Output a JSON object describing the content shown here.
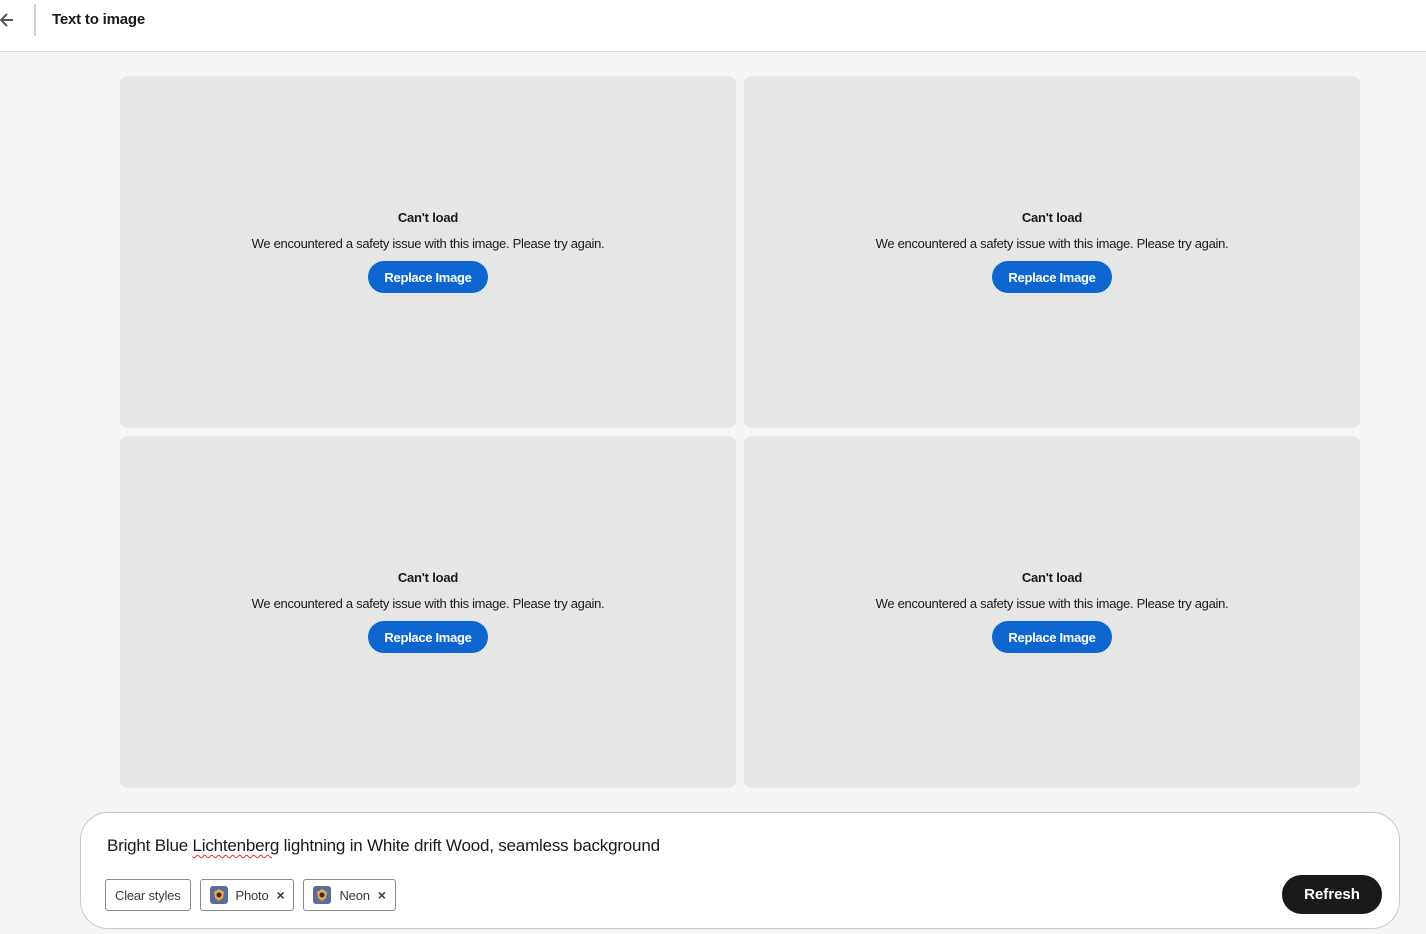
{
  "header": {
    "back_icon": "arrow-left-icon",
    "title": "Text to image"
  },
  "results": [
    {
      "title": "Can't load",
      "message": "We encountered a safety issue with this image. Please try again.",
      "button_label": "Replace Image"
    },
    {
      "title": "Can't load",
      "message": "We encountered a safety issue with this image. Please try again.",
      "button_label": "Replace Image"
    },
    {
      "title": "Can't load",
      "message": "We encountered a safety issue with this image. Please try again.",
      "button_label": "Replace Image"
    },
    {
      "title": "Can't load",
      "message": "We encountered a safety issue with this image. Please try again.",
      "button_label": "Replace Image"
    }
  ],
  "prompt": {
    "text_before": "Bright Blue ",
    "text_misspelled": "Lichtenberg",
    "text_after": " lightning in White drift Wood, seamless background",
    "chips": {
      "clear_label": "Clear styles",
      "styles": [
        {
          "label": "Photo",
          "icon": "style-thumbnail-icon"
        },
        {
          "label": "Neon",
          "icon": "style-thumbnail-icon"
        }
      ],
      "remove_glyph": "×"
    },
    "refresh_label": "Refresh"
  },
  "colors": {
    "accent_blue": "#0d66d0",
    "card_bg": "#e6e6e6",
    "refresh_bg": "#1a1a1a",
    "spellcheck": "#e03030"
  }
}
